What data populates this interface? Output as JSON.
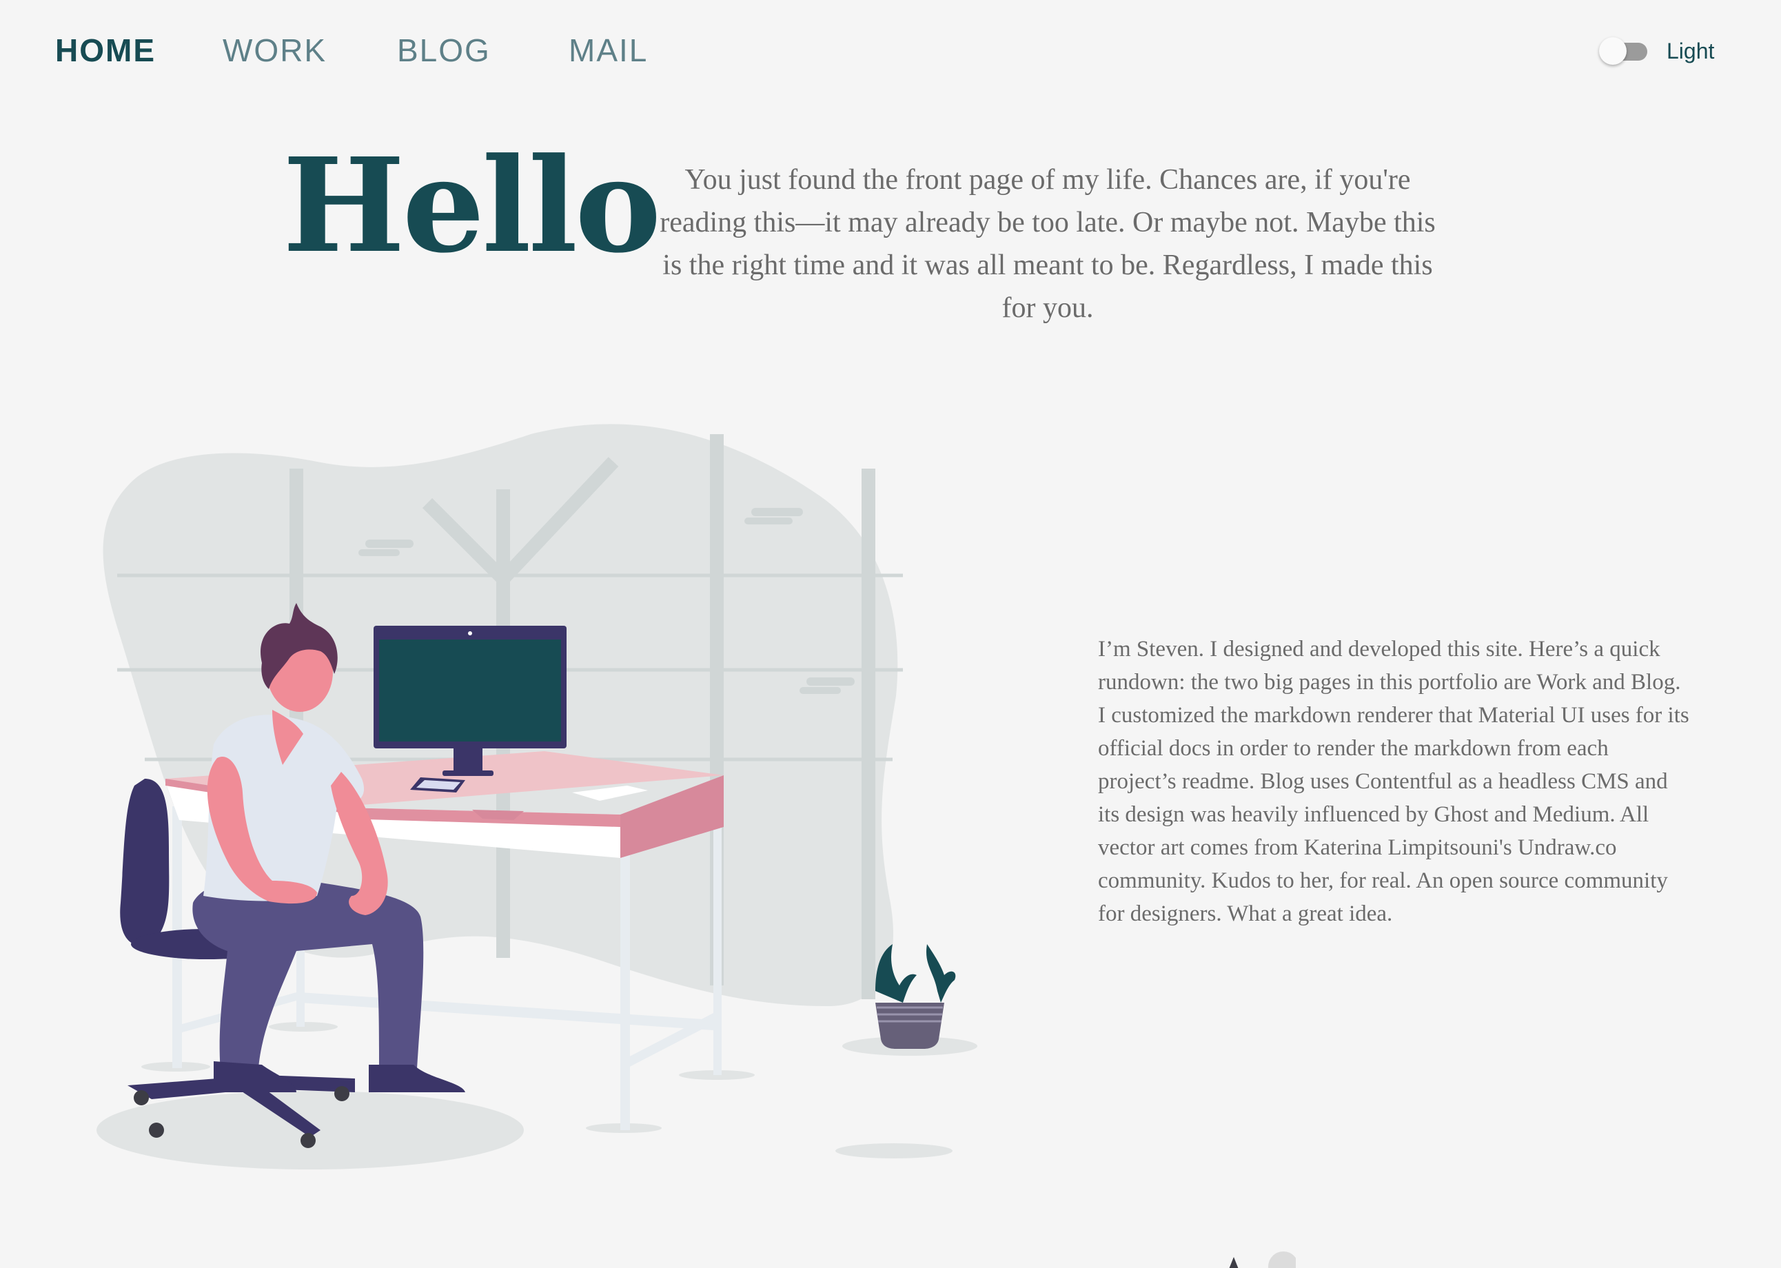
{
  "nav": {
    "items": [
      {
        "label": "HOME",
        "active": true
      },
      {
        "label": "WORK",
        "active": false
      },
      {
        "label": "BLOG",
        "active": false
      },
      {
        "label": "MAIL",
        "active": false
      }
    ],
    "theme_toggle": {
      "label": "Light",
      "state": "off"
    }
  },
  "hero": {
    "title": "Hello",
    "intro": "You just found the front page of my life. Chances are, if you're reading this—it may already be too late. Or maybe not. Maybe this is the right time and it was all meant to be. Regardless, I made this for you."
  },
  "bio": {
    "text": "I’m Steven. I designed and developed this site. Here’s a quick rundown: the two big pages in this portfolio are Work and Blog. I customized the markdown renderer that Material UI uses for its official docs in order to render the markdown from each project’s readme. Blog uses Contentful as a headless CMS and its design was heavily influenced by Ghost and Medium. All vector art comes from Katerina Limpitsouni's Undraw.co community. Kudos to her, for real. An open source community for designers. What a great idea."
  },
  "illustration": {
    "name": "person-at-desk-illustration",
    "colors": {
      "primary": "#174b53",
      "accent_pink": "#f08c97",
      "desk_pink": "#efc3c8",
      "pants": "#575185",
      "chair": "#3b3568",
      "backdrop": "#e1e4e4"
    }
  },
  "theme": {
    "primary": "#174b53",
    "nav_inactive": "#5e8088",
    "text_muted": "#6b6b6b",
    "background": "#f5f5f5"
  }
}
